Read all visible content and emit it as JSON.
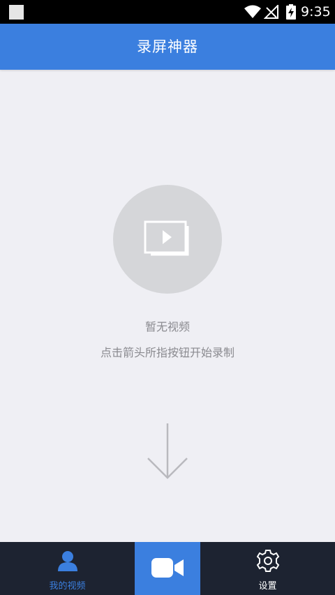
{
  "status_bar": {
    "time": "9:35"
  },
  "app_bar": {
    "title": "录屏神器"
  },
  "empty_state": {
    "title": "暂无视频",
    "hint": "点击箭头所指按钮开始录制"
  },
  "bottom_nav": {
    "items": [
      {
        "label": "我的视频",
        "icon": "person-icon",
        "active": true
      },
      {
        "label": "",
        "icon": "video-camera-icon",
        "active": false
      },
      {
        "label": "设置",
        "icon": "gear-icon",
        "active": false
      }
    ]
  },
  "colors": {
    "primary": "#3b7fdf",
    "nav_background": "#1d2331",
    "page_background": "#efeff4",
    "muted_text": "#8a8a8f"
  }
}
